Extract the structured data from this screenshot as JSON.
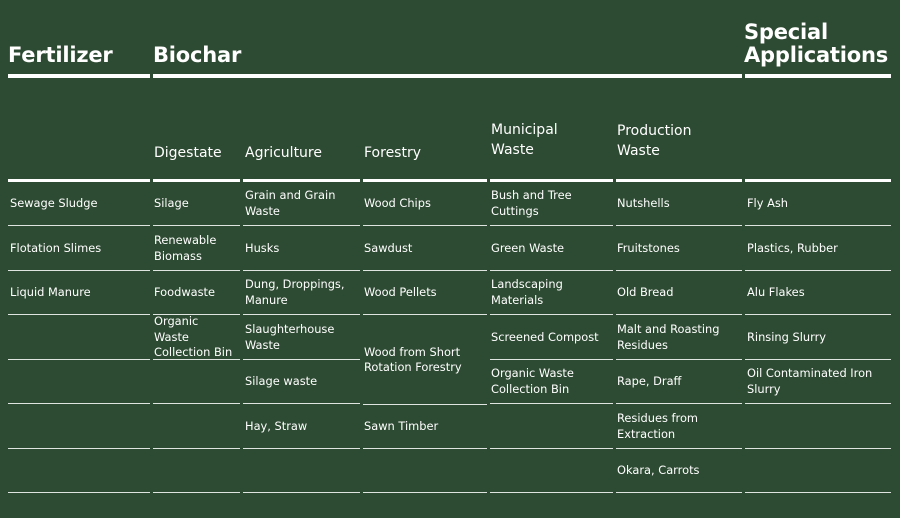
{
  "headers": {
    "fertilizer": "Fertilizer",
    "biochar": "Biochar",
    "special": "Special Applications"
  },
  "categories": [
    "",
    "Digestate",
    "Agriculture",
    "Forestry",
    "Municipal Waste",
    "Production Waste",
    ""
  ],
  "columns": [
    {
      "id": "fertilizer",
      "cells": [
        "Sewage Sludge",
        "Flotation Slimes",
        "Liquid Manure",
        "",
        "",
        "",
        ""
      ]
    },
    {
      "id": "digestate",
      "cells": [
        "Silage",
        "Renewable Biomass",
        "Foodwaste",
        "Organic Waste Collection Bin",
        "",
        "",
        ""
      ]
    },
    {
      "id": "agriculture",
      "cells": [
        "Grain and Grain Waste",
        "Husks",
        "Dung, Droppings, Manure",
        "Slaughterhouse Waste",
        "Silage waste",
        "Hay, Straw",
        ""
      ]
    },
    {
      "id": "forestry",
      "cells": [
        "Wood Chips",
        "Sawdust",
        "Wood Pellets",
        "Wood from Short Rotation Forestry",
        "",
        "Sawn Timber",
        ""
      ]
    },
    {
      "id": "municipal",
      "cells": [
        "Bush and Tree Cuttings",
        "Green Waste",
        "Landscaping Materials",
        "Screened Compost",
        "Organic Waste Collection Bin",
        "",
        ""
      ]
    },
    {
      "id": "production",
      "cells": [
        "Nutshells",
        "Fruitstones",
        "Old Bread",
        "Malt and Roasting Residues",
        "Rape, Draff",
        "Residues from Extraction",
        "Okara, Carrots"
      ]
    },
    {
      "id": "special",
      "cells": [
        "Fly Ash",
        "Plastics, Rubber",
        "Alu Flakes",
        "Rinsing Slurry",
        "Oil Contaminated Iron Slurry",
        "",
        ""
      ]
    }
  ]
}
